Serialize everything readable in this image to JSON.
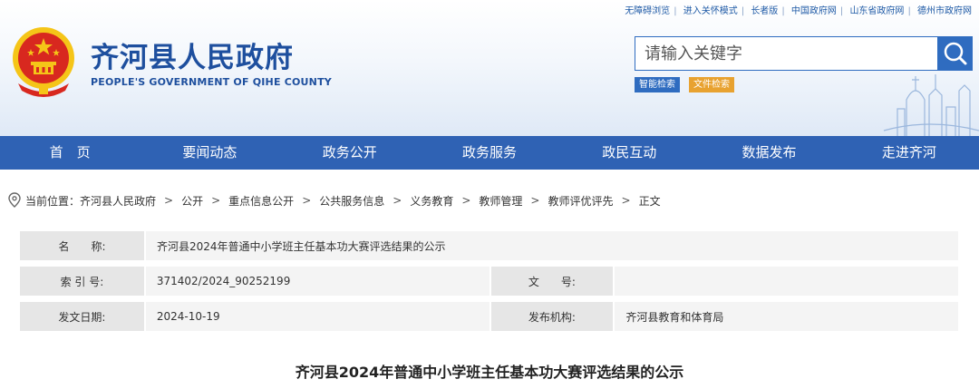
{
  "top_links": [
    "无障碍浏览",
    "进入关怀模式",
    "长者版",
    "中国政府网",
    "山东省政府网",
    "德州市政府网"
  ],
  "site": {
    "title": "齐河县人民政府",
    "subtitle": "PEOPLE'S GOVERNMENT OF QIHE COUNTY"
  },
  "search": {
    "placeholder": "请输入关键字",
    "smart_label": "智能检索",
    "file_label": "文件检索"
  },
  "nav": [
    "首　页",
    "要闻动态",
    "政务公开",
    "政务服务",
    "政民互动",
    "数据发布",
    "走进齐河"
  ],
  "breadcrumb": {
    "prefix": "当前位置：",
    "items": [
      "齐河县人民政府",
      "公开",
      "重点信息公开",
      "公共服务信息",
      "义务教育",
      "教师管理",
      "教师评优评先"
    ],
    "current": "正文"
  },
  "meta": {
    "name_label": "名　　称:",
    "name_value": "齐河县2024年普通中小学班主任基本功大赛评选结果的公示",
    "index_label": "索 引 号:",
    "index_value": "371402/2024_90252199",
    "doc_label": "文　　号:",
    "doc_value": "",
    "date_label": "发文日期:",
    "date_value": "2024-10-19",
    "org_label": "发布机构:",
    "org_value": "齐河县教育和体育局"
  },
  "article_title": "齐河县2024年普通中小学班主任基本功大赛评选结果的公示",
  "colors": {
    "brand_blue": "#1e4f9e",
    "nav_blue": "#2f62b4",
    "search_blue": "#2f6cc0",
    "file_orange": "#e8a230",
    "emblem_red": "#d8281f",
    "emblem_gold": "#f5c518"
  }
}
